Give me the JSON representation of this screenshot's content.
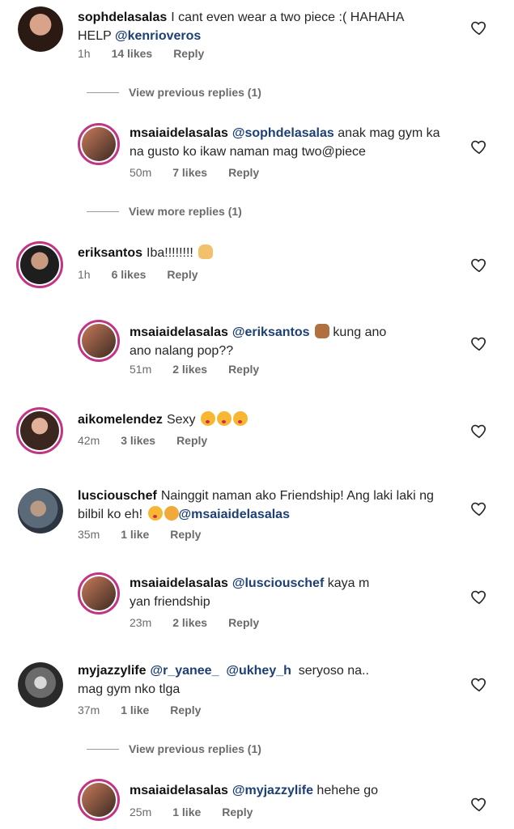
{
  "comments": [
    {
      "user": "sophdelasalas",
      "text": "I cant even wear a two piece :( HAHAHA HELP",
      "mention": "@kenrioveros",
      "time": "1h",
      "likes": "14 likes",
      "reply": "Reply"
    },
    {
      "user": "msaiaidelasalas",
      "mention": "@sophdelasalas",
      "text": "anak mag gym ka na gusto ko ikaw naman mag two@piece",
      "time": "50m",
      "likes": "7 likes",
      "reply": "Reply"
    },
    {
      "user": "eriksantos",
      "text": "Iba!!!!!!!!",
      "time": "1h",
      "likes": "6 likes",
      "reply": "Reply"
    },
    {
      "user": "msaiaidelasalas",
      "mention": "@eriksantos",
      "text": "kung ano ano nalang pop??",
      "time": "51m",
      "likes": "2 likes",
      "reply": "Reply"
    },
    {
      "user": "aikomelendez",
      "text": "Sexy",
      "time": "42m",
      "likes": "3 likes",
      "reply": "Reply"
    },
    {
      "user": "lusciouschef",
      "text": "Nainggit naman ako Friendship! Ang laki laki ng bilbil ko eh!",
      "mention": "@msaiaidelasalas",
      "time": "35m",
      "likes": "1 like",
      "reply": "Reply"
    },
    {
      "user": "msaiaidelasalas",
      "mention": "@lusciouschef",
      "text": "kaya m yan friendship",
      "time": "23m",
      "likes": "2 likes",
      "reply": "Reply"
    },
    {
      "user": "myjazzylife",
      "mention": "@r_yanee_",
      "mention2": "@ukhey_h",
      "text": "seryoso na.. mag gym nko tlga",
      "time": "37m",
      "likes": "1 like",
      "reply": "Reply"
    },
    {
      "user": "msaiaidelasalas",
      "mention": "@myjazzylife",
      "text": "hehehe go",
      "time": "25m",
      "likes": "1 like",
      "reply": "Reply"
    }
  ],
  "view_replies": [
    "View previous replies (1)",
    "View more replies (1)",
    "View previous replies (1)"
  ],
  "icons": {
    "heart": "heart-outline-icon",
    "emoji": [
      "raising-hands-emoji",
      "thumbs-up-emoji",
      "kiss-emoji",
      "smile-emoji"
    ]
  },
  "colors": {
    "mention": "#1d3f75",
    "story_ring": "#c13584",
    "meta": "#6b6b6b"
  }
}
